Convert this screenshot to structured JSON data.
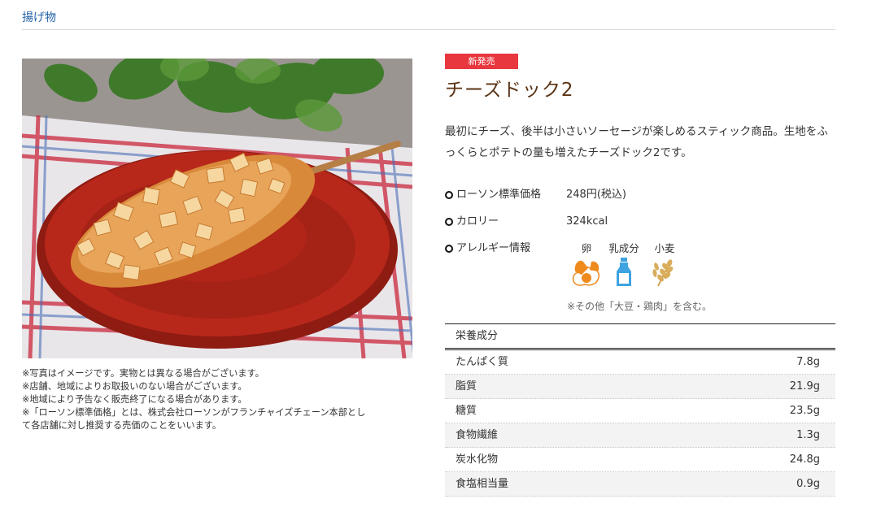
{
  "breadcrumb": "揚げ物",
  "product": {
    "badge": "新発売",
    "title": "チーズドック2",
    "description": "最初にチーズ、後半は小さいソーセージが楽しめるスティック商品。生地をふっくらとポテトの量も増えたチーズドック2です。"
  },
  "notes": [
    "※写真はイメージです。実物とは異なる場合がございます。",
    "※店舗、地域によりお取扱いのない場合がございます。",
    "※地域により予告なく販売終了になる場合があります。",
    "※「ローソン標準価格」とは、株式会社ローソンがフランチャイズチェーン本部とし",
    "て各店舗に対し推奨する売価のことをいいます。"
  ],
  "info": {
    "price_label": "ローソン標準価格",
    "price_value": "248円(税込)",
    "calorie_label": "カロリー",
    "calorie_value": "324kcal",
    "allergy_label": "アレルギー情報"
  },
  "allergens": [
    {
      "name": "卵",
      "icon": "egg-icon"
    },
    {
      "name": "乳成分",
      "icon": "milk-icon"
    },
    {
      "name": "小麦",
      "icon": "wheat-icon"
    }
  ],
  "allergy_note": "※その他「大豆・鶏肉」を含む。",
  "nutrition": {
    "heading": "栄養成分",
    "rows": [
      {
        "name": "たんぱく質",
        "value": "7.8g"
      },
      {
        "name": "脂質",
        "value": "21.9g"
      },
      {
        "name": "糖質",
        "value": "23.5g"
      },
      {
        "name": "食物繊維",
        "value": "1.3g"
      },
      {
        "name": "炭水化物",
        "value": "24.8g"
      },
      {
        "name": "食塩相当量",
        "value": "0.9g"
      }
    ]
  },
  "colors": {
    "badge": "#e8373e",
    "title": "#5a3315",
    "breadcrumb": "#1f5fa6",
    "allergen_orange": "#ef8a1d",
    "milk_blue": "#3ea3e0"
  }
}
